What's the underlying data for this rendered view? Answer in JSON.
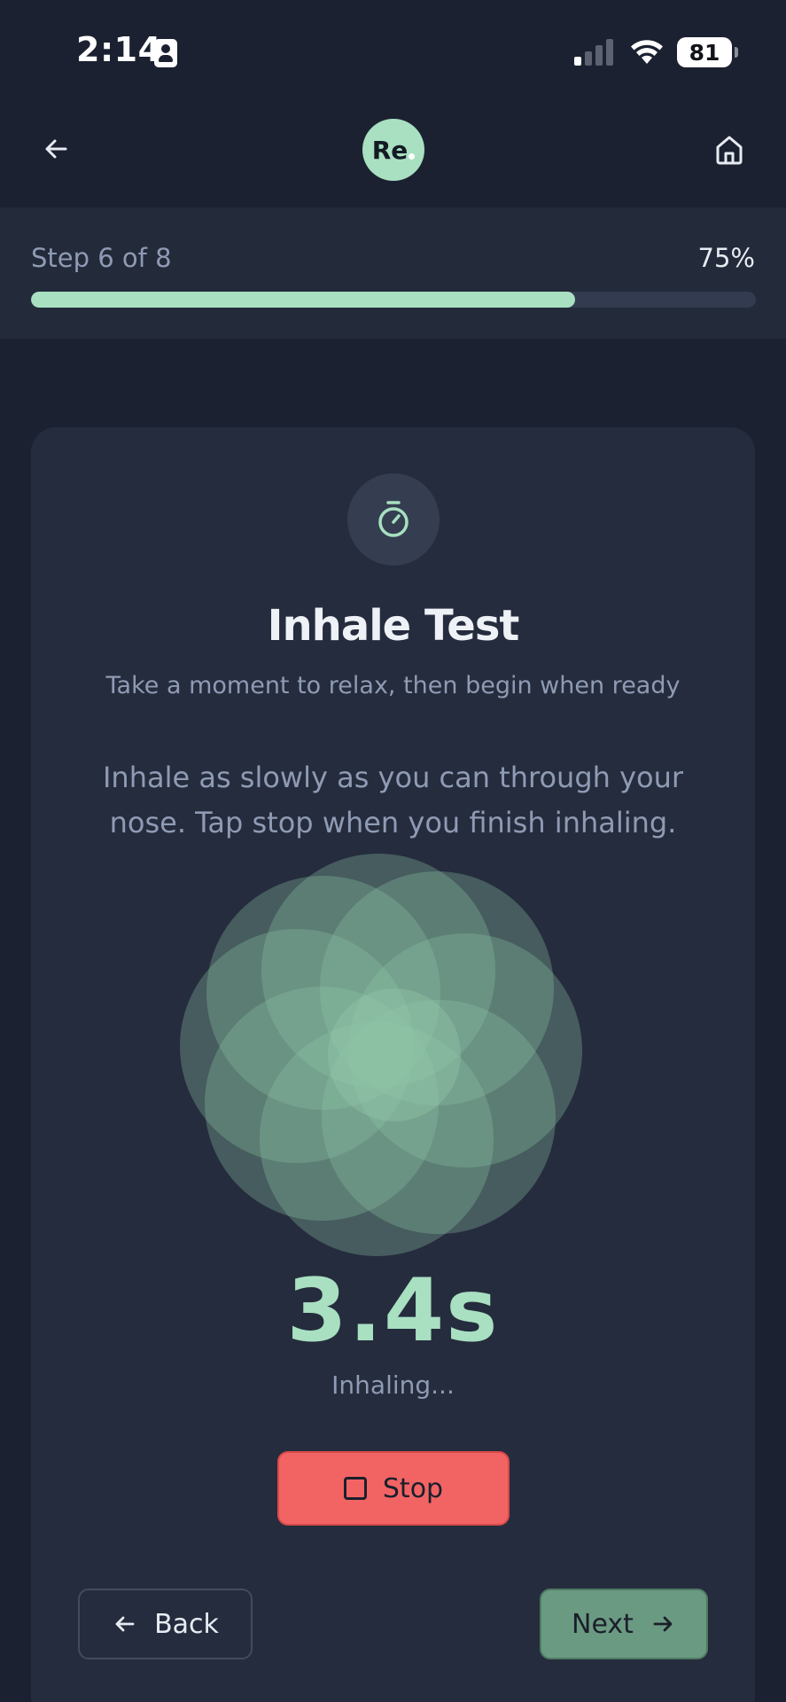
{
  "status_bar": {
    "time": "2:14",
    "battery": "81",
    "icons": [
      "contact-card-icon",
      "cellular-signal-icon",
      "wifi-icon",
      "battery-icon"
    ]
  },
  "nav": {
    "logo_text": "Re",
    "back_icon": "arrow-left-icon",
    "home_icon": "home-icon"
  },
  "progress": {
    "step_label": "Step 6 of 8",
    "percent_label": "75%",
    "fraction": 0.75
  },
  "card": {
    "icon": "stopwatch-icon",
    "title": "Inhale Test",
    "subtitle": "Take a moment to relax, then begin when ready",
    "instructions": "Inhale as slowly as you can through your nose. Tap stop when you finish inhaling.",
    "timer_value": "3.4s",
    "timer_status": "Inhaling...",
    "stop_label": "Stop",
    "back_label": "Back",
    "next_label": "Next"
  },
  "colors": {
    "background": "#1b2130",
    "card": "#252c3d",
    "accent": "#a8e0c1",
    "stop": "#f26464",
    "next": "#6b9a82",
    "muted_text": "#8f9bb4"
  }
}
